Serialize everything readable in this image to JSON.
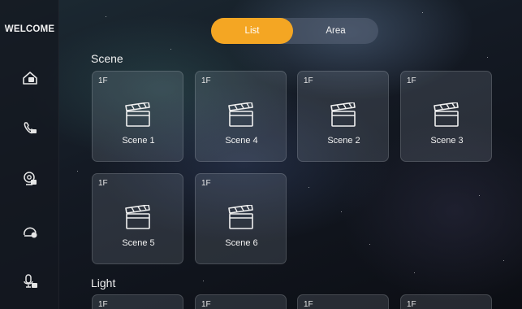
{
  "sidebar": {
    "welcome": "WELCOME",
    "items": [
      {
        "icon": "home-icon"
      },
      {
        "icon": "phone-icon"
      },
      {
        "icon": "camera-icon"
      },
      {
        "icon": "clock-icon"
      },
      {
        "icon": "microphone-icon"
      }
    ]
  },
  "toggle": {
    "list_label": "List",
    "area_label": "Area",
    "active": "List",
    "accent": "#f4a623"
  },
  "scene": {
    "title": "Scene",
    "cards": [
      {
        "floor": "1F",
        "name": "Scene 1",
        "icon": "clapperboard-icon"
      },
      {
        "floor": "1F",
        "name": "Scene 4",
        "icon": "clapperboard-icon"
      },
      {
        "floor": "1F",
        "name": "Scene 2",
        "icon": "clapperboard-icon"
      },
      {
        "floor": "1F",
        "name": "Scene 3",
        "icon": "clapperboard-icon"
      },
      {
        "floor": "1F",
        "name": "Scene 5",
        "icon": "clapperboard-icon"
      },
      {
        "floor": "1F",
        "name": "Scene 6",
        "icon": "clapperboard-icon"
      }
    ]
  },
  "light": {
    "title": "Light",
    "cards": [
      {
        "floor": "1F"
      },
      {
        "floor": "1F"
      },
      {
        "floor": "1F"
      },
      {
        "floor": "1F"
      }
    ]
  }
}
